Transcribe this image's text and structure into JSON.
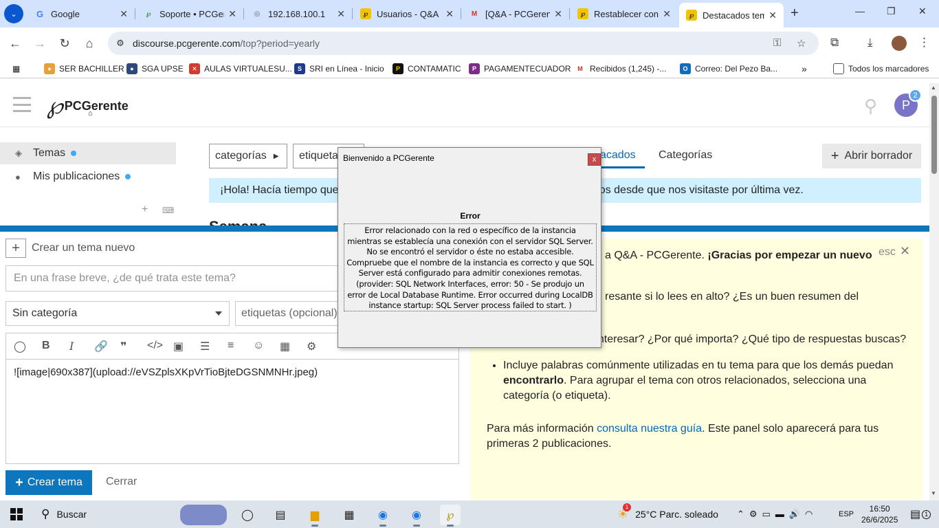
{
  "browser": {
    "tabs": [
      {
        "label": "Google",
        "active": false
      },
      {
        "label": "Soporte • PCGerente",
        "active": false
      },
      {
        "label": "192.168.100.1",
        "active": false
      },
      {
        "label": "Usuarios - Q&A",
        "active": false
      },
      {
        "label": "[Q&A - PCGerente]",
        "active": false
      },
      {
        "label": "Restablecer contraseña",
        "active": false
      },
      {
        "label": "Destacados temas",
        "active": true
      }
    ],
    "url_host": "discourse.pcgerente.com",
    "url_path": "/top?period=yearly",
    "bookmarks": [
      {
        "label": "SER BACHILLER",
        "color": "#e8a13a"
      },
      {
        "label": "SGA UPSE",
        "color": "#2f4a7a"
      },
      {
        "label": "AULAS VIRTUALESU...",
        "color": "#d33b2f"
      },
      {
        "label": "SRI en Línea - Inicio",
        "color": "#1f3a8a"
      },
      {
        "label": "CONTAMATIC",
        "color": "#111111"
      },
      {
        "label": "PAGAMENTECUADOR",
        "color": "#7b2c86"
      },
      {
        "label": "Recibidos (1,245) -...",
        "color": "#d93025"
      },
      {
        "label": "Correo: Del Pezo Ba...",
        "color": "#0f6cbd"
      }
    ],
    "all_bookmarks": "Todos los marcadores"
  },
  "site": {
    "logo_text": "PCGerente",
    "user_initial": "P",
    "notifications": "2",
    "sidebar": {
      "topics": "Temas",
      "my_posts": "Mis publicaciones"
    },
    "nav": {
      "categories_drop": "categorías",
      "tags_drop": "etiquetas",
      "featured": "Destacados",
      "featured_visible": "acados",
      "categories_link": "Categorías",
      "open_draft": "Abrir borrador"
    },
    "banner": "¡Hola! Hacía tiempo que no te veíamos. Estos son los temas más destacados desde que nos visitaste por última vez.",
    "banner_left": "¡Hola! Hacía tiempo que",
    "banner_right": "ados desde que nos visitaste por última vez.",
    "section_title": "Semana"
  },
  "composer": {
    "header": "Crear un tema nuevo",
    "title_placeholder": "En una frase breve, ¿de qué trata este tema?",
    "category": "Sin categoría",
    "tags_placeholder": "etiquetas (opcional)",
    "body_text": "![image|690x387](upload://eVSZplsXKpVrTioBjteDGSNMNHr.jpeg)",
    "create_button": "Crear tema",
    "close_link": "Cerrar"
  },
  "tips": {
    "esc": "esc",
    "p1_a": "a Q&A - PCGerente. ",
    "p1_b": "¡Gracias por empezar un nuevo",
    "p2": "resante si lo lees en alto? ¿Es un buen resumen del",
    "li1": "¿A quién le podría interesar? ¿Por qué importa? ¿Qué tipo de respuestas buscas?",
    "li2_a": "Incluye palabras comúnmente utilizadas en tu tema para que los demás puedan ",
    "li2_b": "encontrarlo",
    "li2_c": ". Para agrupar el tema con otros relacionados, selecciona una categoría (o etiqueta).",
    "foot_a": "Para más información ",
    "foot_link": "consulta nuestra guía",
    "foot_b": ". Este panel solo aparecerá para tus primeras 2 publicaciones."
  },
  "dialog": {
    "title": "Bienvenido a PCGerente",
    "close": "x",
    "heading": "Error",
    "message": "Error relacionado con la red o específico de la instancia mientras se establecía una conexión con el servidor SQL Server. No se encontró el servidor o éste no estaba accesible. Compruebe que el nombre de la instancia es correcto y que SQL Server está configurado para admitir conexiones remotas. (provider: SQL Network Interfaces, error: 50 - Se produjo un error de Local Database Runtime. Error occurred during LocalDB instance startup: SQL Server process failed to start. )"
  },
  "taskbar": {
    "search": "Buscar",
    "weather": "25°C  Parc. soleado",
    "weather_badge": "1",
    "language": "ESP",
    "time": "16:50",
    "date": "26/6/2025",
    "notif_count": "1"
  }
}
